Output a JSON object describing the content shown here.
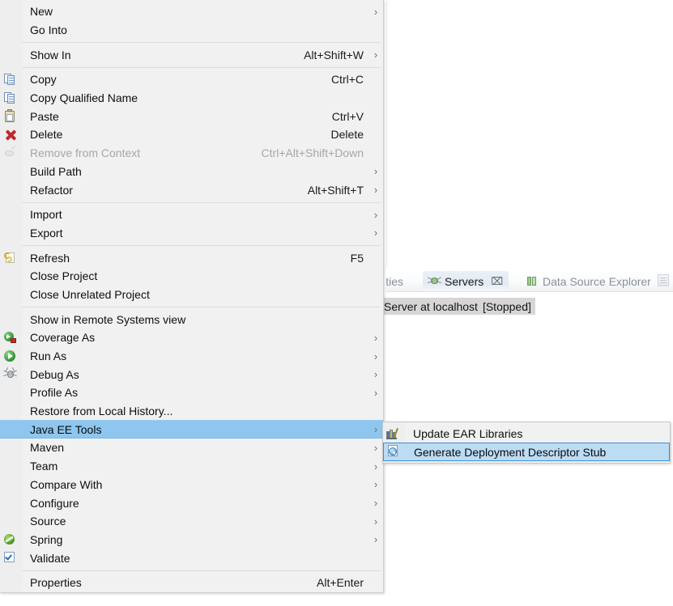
{
  "background": {
    "tabs": [
      {
        "label": "perties",
        "icon": "",
        "state": "inactive",
        "name": "tab-properties"
      },
      {
        "label": "Servers",
        "icon": "servers-icon",
        "state": "active",
        "close": "⌧",
        "name": "tab-servers"
      },
      {
        "label": "Data Source Explorer",
        "icon": "data-source-explorer-icon",
        "state": "inactive",
        "name": "tab-data-source-explorer"
      }
    ],
    "server_entry": {
      "name": "Server at localhost",
      "status": "[Stopped]"
    }
  },
  "context_menu": {
    "groups": [
      {
        "items": [
          {
            "label": "New",
            "accel": "",
            "arrow": true,
            "icon": null,
            "disabled": false,
            "name": "menu-item-new"
          },
          {
            "label": "Go Into",
            "accel": "",
            "arrow": false,
            "icon": null,
            "disabled": false,
            "name": "menu-item-go-into"
          }
        ]
      },
      {
        "items": [
          {
            "label": "Show In",
            "accel": "Alt+Shift+W",
            "arrow": true,
            "icon": null,
            "disabled": false,
            "name": "menu-item-show-in"
          }
        ]
      },
      {
        "items": [
          {
            "label": "Copy",
            "accel": "Ctrl+C",
            "arrow": false,
            "icon": "copy-icon",
            "disabled": false,
            "name": "menu-item-copy"
          },
          {
            "label": "Copy Qualified Name",
            "accel": "",
            "arrow": false,
            "icon": "copy-qualified-name-icon",
            "disabled": false,
            "name": "menu-item-copy-qualified-name"
          },
          {
            "label": "Paste",
            "accel": "Ctrl+V",
            "arrow": false,
            "icon": "paste-icon",
            "disabled": false,
            "name": "menu-item-paste"
          },
          {
            "label": "Delete",
            "accel": "Delete",
            "arrow": false,
            "icon": "delete-icon",
            "disabled": false,
            "name": "menu-item-delete"
          },
          {
            "label": "Remove from Context",
            "accel": "Ctrl+Alt+Shift+Down",
            "arrow": false,
            "icon": "remove-from-context-icon",
            "disabled": true,
            "name": "menu-item-remove-from-context"
          },
          {
            "label": "Build Path",
            "accel": "",
            "arrow": true,
            "icon": null,
            "disabled": false,
            "name": "menu-item-build-path"
          },
          {
            "label": "Refactor",
            "accel": "Alt+Shift+T",
            "arrow": true,
            "icon": null,
            "disabled": false,
            "name": "menu-item-refactor"
          }
        ]
      },
      {
        "items": [
          {
            "label": "Import",
            "accel": "",
            "arrow": true,
            "icon": null,
            "disabled": false,
            "name": "menu-item-import"
          },
          {
            "label": "Export",
            "accel": "",
            "arrow": true,
            "icon": null,
            "disabled": false,
            "name": "menu-item-export"
          }
        ]
      },
      {
        "items": [
          {
            "label": "Refresh",
            "accel": "F5",
            "arrow": false,
            "icon": "refresh-icon",
            "disabled": false,
            "name": "menu-item-refresh"
          },
          {
            "label": "Close Project",
            "accel": "",
            "arrow": false,
            "icon": null,
            "disabled": false,
            "name": "menu-item-close-project"
          },
          {
            "label": "Close Unrelated Project",
            "accel": "",
            "arrow": false,
            "icon": null,
            "disabled": false,
            "name": "menu-item-close-unrelated-project"
          }
        ]
      },
      {
        "items": [
          {
            "label": "Show in Remote Systems view",
            "accel": "",
            "arrow": false,
            "icon": null,
            "disabled": false,
            "name": "menu-item-show-in-remote-systems-view"
          },
          {
            "label": "Coverage As",
            "accel": "",
            "arrow": true,
            "icon": "coverage-as-icon",
            "disabled": false,
            "name": "menu-item-coverage-as"
          },
          {
            "label": "Run As",
            "accel": "",
            "arrow": true,
            "icon": "run-as-icon",
            "disabled": false,
            "name": "menu-item-run-as"
          },
          {
            "label": "Debug As",
            "accel": "",
            "arrow": true,
            "icon": "debug-as-icon",
            "disabled": false,
            "name": "menu-item-debug-as"
          },
          {
            "label": "Profile As",
            "accel": "",
            "arrow": true,
            "icon": null,
            "disabled": false,
            "name": "menu-item-profile-as"
          },
          {
            "label": "Restore from Local History...",
            "accel": "",
            "arrow": false,
            "icon": null,
            "disabled": false,
            "name": "menu-item-restore-from-local-history"
          },
          {
            "label": "Java EE Tools",
            "accel": "",
            "arrow": true,
            "icon": null,
            "disabled": false,
            "selected": true,
            "name": "menu-item-java-ee-tools"
          },
          {
            "label": "Maven",
            "accel": "",
            "arrow": true,
            "icon": null,
            "disabled": false,
            "name": "menu-item-maven"
          },
          {
            "label": "Team",
            "accel": "",
            "arrow": true,
            "icon": null,
            "disabled": false,
            "name": "menu-item-team"
          },
          {
            "label": "Compare With",
            "accel": "",
            "arrow": true,
            "icon": null,
            "disabled": false,
            "name": "menu-item-compare-with"
          },
          {
            "label": "Configure",
            "accel": "",
            "arrow": true,
            "icon": null,
            "disabled": false,
            "name": "menu-item-configure"
          },
          {
            "label": "Source",
            "accel": "",
            "arrow": true,
            "icon": null,
            "disabled": false,
            "name": "menu-item-source"
          },
          {
            "label": "Spring",
            "accel": "",
            "arrow": true,
            "icon": "spring-icon",
            "disabled": false,
            "name": "menu-item-spring"
          },
          {
            "label": "Validate",
            "accel": "",
            "arrow": false,
            "icon": "validate-icon",
            "disabled": false,
            "name": "menu-item-validate"
          }
        ]
      },
      {
        "items": [
          {
            "label": "Properties",
            "accel": "Alt+Enter",
            "arrow": false,
            "icon": null,
            "disabled": false,
            "name": "menu-item-properties"
          }
        ]
      }
    ]
  },
  "submenu": {
    "parent": "Java EE Tools",
    "items": [
      {
        "label": "Update EAR Libraries",
        "icon": "update-ear-libraries-icon",
        "selected": false,
        "name": "submenu-item-update-ear-libraries"
      },
      {
        "label": "Generate Deployment Descriptor Stub",
        "icon": "generate-deployment-descriptor-stub-icon",
        "selected": true,
        "name": "submenu-item-generate-deployment-descriptor-stub"
      }
    ]
  },
  "colors": {
    "menu_background": "#f1f1f1",
    "menu_gutter": "#eeeeee",
    "highlight": "#8ec6ef",
    "submenu_highlight": "#bcdcf4",
    "submenu_highlight_border": "#3c8fd0",
    "disabled_text": "#a6a6a6",
    "text": "#0e0e0e",
    "separator": "#dcdcdc",
    "selection_grey": "#d6d6d6"
  },
  "glyphs": {
    "arrow_right": "›"
  }
}
